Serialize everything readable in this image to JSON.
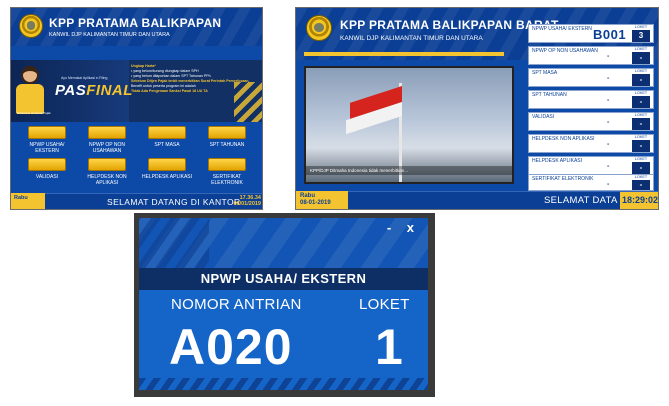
{
  "kiosk": {
    "title": "KPP PRATAMA BALIKPAPAN",
    "subtitle": "KANWIL DJP KALIMANTAN TIMUR DAN UTARA",
    "banner": {
      "small_text": "Ayo Memakai Aplikasi e-Filing",
      "brand_a": "PAS",
      "brand_b": "FINAL",
      "info_title": "Ungkap Harta*",
      "info_1": "• yang belum/kurang diungkap dalam SPH",
      "info_2": "• yang belum dilaporkan dalam SPT Tahunan PPh",
      "info_3": "Sebelum Ditjen Pajak terbit menerbitkan Surat Perintah Pemeriksaan.",
      "info_4": "Benefit untuk peserta program ini adalah",
      "info_5": "Tidak Ada Pengenaan Sanksi Pasal 18 UU TA",
      "foot": "Direktorat Jenderal Pajak"
    },
    "services": [
      "NPWP USAHA/ EKSTERN",
      "NPWP OP NON USAHAWAN",
      "SPT MASA",
      "SPT TAHUNAN",
      "VALIDASI",
      "HELPDESK NON APLIKASI",
      "HELPDESK APLIKASI",
      "SERTIFIKAT ELEKTRONIK"
    ],
    "day": "Rabu",
    "welcome": "SELAMAT DATANG DI KANTOR",
    "time": "17.36.34",
    "date": "08/01/2019"
  },
  "display": {
    "title": "KPP PRATAMA BALIKPAPAN BARAT",
    "subtitle": "KANWIL DJP KALIMANTAN TIMUR DAN UTARA",
    "video_caption": "KPP/DJP Ditmaha Indonesia tidak menerbitkan...",
    "loket_label": "LOKET",
    "rows": [
      {
        "name": "NPWP USAHA/ EKSTERN",
        "number": "B001",
        "loket": "3"
      },
      {
        "name": "NPWP OP NON USAHAWAN",
        "number": "-",
        "loket": "-"
      },
      {
        "name": "SPT MASA",
        "number": "-",
        "loket": "-"
      },
      {
        "name": "SPT TAHUNAN",
        "number": "-",
        "loket": "-"
      },
      {
        "name": "VALIDASI",
        "number": "-",
        "loket": "-"
      },
      {
        "name": "HELPDESK NON APLIKASI",
        "number": "-",
        "loket": "-"
      },
      {
        "name": "HELPDESK APLIKASI",
        "number": "-",
        "loket": "-"
      },
      {
        "name": "SERTIFIKAT ELEKTRONIK",
        "number": "-",
        "loket": "-"
      }
    ],
    "day": "Rabu",
    "date": "08-01-2019",
    "welcome": "SELAMAT DATA",
    "time": "18:29:02"
  },
  "popup": {
    "controls": "- x",
    "service": "NPWP USAHA/ EKSTERN",
    "nomor_label": "NOMOR ANTRIAN",
    "loket_label": "LOKET",
    "nomor": "A020",
    "loket": "1"
  }
}
